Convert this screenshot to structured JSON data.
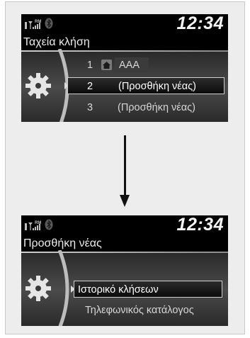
{
  "screen_top": {
    "status": {
      "signal_label": "RM",
      "clock": "12:34",
      "signal_icon": "signal-bars-icon",
      "bluetooth_icon": "bluetooth-icon"
    },
    "title": "Ταχεία κλήση",
    "items": [
      {
        "number": "1",
        "label": "AAA",
        "icon": "home-icon"
      },
      {
        "number": "2",
        "label": "(Προσθήκη νέας)"
      },
      {
        "number": "3",
        "label": "(Προσθήκη νέας)"
      }
    ],
    "selected_index": 1
  },
  "screen_bottom": {
    "status": {
      "signal_label": "RM",
      "clock": "12:34",
      "signal_icon": "signal-bars-icon",
      "bluetooth_icon": "bluetooth-icon"
    },
    "title": "Προσθήκη νέας",
    "items": [
      {
        "label": "Ιστορικό κλήσεων"
      },
      {
        "label": "Τηλεφωνικός κατάλογος"
      }
    ],
    "selected_index": 0
  },
  "transition_icon": "arrow-down-icon"
}
